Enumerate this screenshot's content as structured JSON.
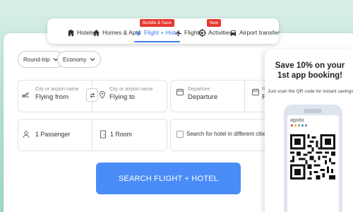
{
  "nav": {
    "tabs": [
      {
        "label": "Hotels",
        "icon": "hotel-icon"
      },
      {
        "label": "Homes & Apts",
        "icon": "home-icon"
      },
      {
        "label": "Flight + Hotel",
        "icon": "flight-hotel-icon",
        "active": true,
        "badge": "Bundle & Save"
      },
      {
        "label": "Flights",
        "icon": "plane-icon"
      },
      {
        "label": "Activities",
        "icon": "activities-icon",
        "badge": "New"
      },
      {
        "label": "Airport transfer",
        "icon": "car-icon"
      }
    ]
  },
  "search": {
    "trip_type": "Round-trip",
    "cabin_class": "Economy",
    "from": {
      "label": "City or airport name",
      "placeholder": "Flying from"
    },
    "to": {
      "label": "City or airport name",
      "placeholder": "Flying to"
    },
    "departure": {
      "label": "Departure",
      "value": "Departure"
    },
    "return": {
      "label": "R",
      "value": "R"
    },
    "passengers": "1 Passenger",
    "rooms": "1 Room",
    "different_cities_label": "Search for hotel in different cities or d",
    "submit_label": "SEARCH FLIGHT + HOTEL"
  },
  "promo": {
    "title": "Save 10% on your 1st app booking!",
    "subtitle": "Just scan the QR code for instant savings",
    "brand": "agoda",
    "brand_dot_colors": [
      "#e8343a",
      "#f6a623",
      "#6ab04c",
      "#3a7be0",
      "#9b59b6"
    ]
  },
  "colors": {
    "accent": "#3e7ae8",
    "cta": "#4a8cf7",
    "badge": "#e53a30",
    "background": "#b7e2d4"
  }
}
